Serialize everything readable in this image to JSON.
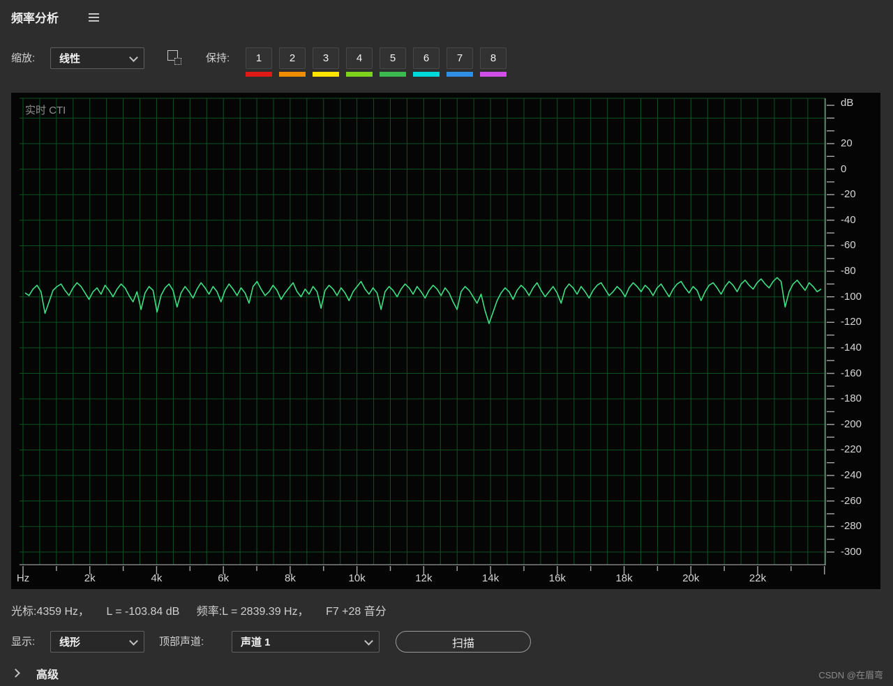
{
  "header": {
    "title": "频率分析"
  },
  "toolbar": {
    "scale_label": "缩放:",
    "scale_value": "线性",
    "hold_label": "保持:",
    "hold_buttons": [
      {
        "label": "1",
        "color": "#e01b17"
      },
      {
        "label": "2",
        "color": "#f08c00"
      },
      {
        "label": "3",
        "color": "#ffe400"
      },
      {
        "label": "4",
        "color": "#7ed41c"
      },
      {
        "label": "5",
        "color": "#3cb94f"
      },
      {
        "label": "6",
        "color": "#00d9d9"
      },
      {
        "label": "7",
        "color": "#2f8fe6"
      },
      {
        "label": "8",
        "color": "#cf4fe8"
      }
    ]
  },
  "chart": {
    "overlay_label": "实时 CTI"
  },
  "chart_data": {
    "type": "line",
    "title": "实时 CTI",
    "x_unit": "Hz",
    "y_unit": "dB",
    "x_range_hz": [
      0,
      24000
    ],
    "y_range_db": [
      -300,
      40
    ],
    "grid_step_hz": 500,
    "grid_step_db": 20,
    "x_tick_labels": [
      "Hz",
      "2k",
      "4k",
      "6k",
      "8k",
      "10k",
      "12k",
      "14k",
      "16k",
      "18k",
      "20k",
      "22k"
    ],
    "y_tick_labels": [
      "dB",
      "20",
      "0",
      "-20",
      "-40",
      "-60",
      "-80",
      "-100",
      "-120",
      "-140",
      "-160",
      "-180",
      "-200",
      "-220",
      "-240",
      "-260",
      "-280",
      "-300"
    ],
    "legend": "off",
    "grid": "on",
    "freq_start_hz": 60,
    "freq_end_hz": 23900,
    "spectrum_db": [
      -97,
      -99,
      -94,
      -91,
      -96,
      -113,
      -104,
      -95,
      -92,
      -90,
      -95,
      -99,
      -93,
      -89,
      -92,
      -97,
      -102,
      -96,
      -93,
      -98,
      -91,
      -95,
      -100,
      -94,
      -90,
      -93,
      -99,
      -104,
      -96,
      -110,
      -97,
      -92,
      -95,
      -112,
      -99,
      -93,
      -90,
      -95,
      -108,
      -97,
      -92,
      -96,
      -101,
      -94,
      -89,
      -93,
      -98,
      -92,
      -96,
      -104,
      -95,
      -90,
      -94,
      -99,
      -93,
      -97,
      -105,
      -92,
      -88,
      -94,
      -99,
      -96,
      -91,
      -95,
      -102,
      -97,
      -93,
      -89,
      -96,
      -100,
      -94,
      -98,
      -92,
      -96,
      -109,
      -95,
      -91,
      -94,
      -99,
      -93,
      -97,
      -103,
      -96,
      -92,
      -88,
      -94,
      -98,
      -93,
      -97,
      -110,
      -96,
      -92,
      -95,
      -100,
      -94,
      -90,
      -93,
      -98,
      -92,
      -96,
      -101,
      -95,
      -91,
      -94,
      -99,
      -93,
      -97,
      -104,
      -110,
      -96,
      -92,
      -95,
      -100,
      -105,
      -98,
      -111,
      -121,
      -112,
      -103,
      -97,
      -93,
      -96,
      -102,
      -95,
      -91,
      -94,
      -99,
      -93,
      -89,
      -95,
      -100,
      -96,
      -92,
      -97,
      -105,
      -94,
      -90,
      -93,
      -98,
      -92,
      -96,
      -101,
      -95,
      -91,
      -89,
      -94,
      -99,
      -96,
      -92,
      -95,
      -100,
      -93,
      -89,
      -92,
      -96,
      -91,
      -94,
      -99,
      -93,
      -90,
      -95,
      -100,
      -94,
      -90,
      -88,
      -93,
      -97,
      -92,
      -95,
      -103,
      -96,
      -91,
      -89,
      -93,
      -98,
      -92,
      -88,
      -91,
      -96,
      -90,
      -87,
      -91,
      -94,
      -89,
      -86,
      -90,
      -93,
      -88,
      -85,
      -88,
      -108,
      -96,
      -90,
      -87,
      -91,
      -95,
      -89,
      -92,
      -96,
      -94
    ],
    "colors": {
      "trace": "#3de184",
      "grid": "#0e5223",
      "background": "#050505",
      "axis_text": "#d6d6d6",
      "tick": "#a8a8a8",
      "border": "#bdbdbd"
    }
  },
  "status": {
    "cursor": "光标:4359 Hz，",
    "level": "L = -103.84 dB",
    "frequency": "频率:L = 2839.39 Hz，",
    "pitch": "F7 +28 音分"
  },
  "controls": {
    "display_label": "显示:",
    "display_value": "线形",
    "top_channel_label": "顶部声道:",
    "top_channel_value": "声道 1",
    "scan_label": "扫描"
  },
  "advanced": {
    "label": "高级"
  },
  "watermark": "CSDN @在眉弯"
}
